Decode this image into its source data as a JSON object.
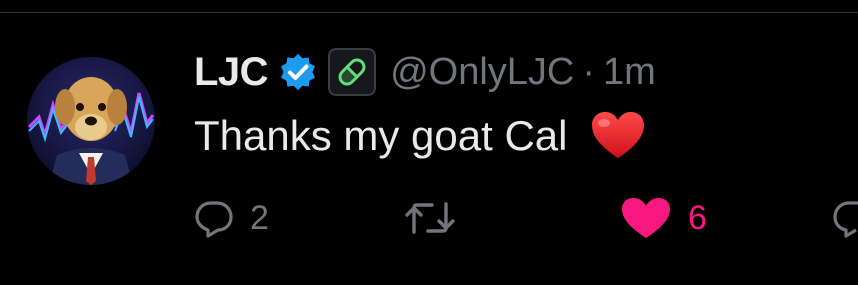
{
  "tweet": {
    "author": {
      "display_name": "LJC",
      "handle": "@OnlyLJC",
      "verified": true,
      "verified_color": "#1d9bf0",
      "badge": "green-pill"
    },
    "separator": "·",
    "time": "1m",
    "text": "Thanks my goat Cal",
    "emoji": "red-heart"
  },
  "actions": {
    "reply": {
      "icon": "reply-icon",
      "count": "2"
    },
    "retweet": {
      "icon": "retweet-icon",
      "count": ""
    },
    "like": {
      "icon": "heart-icon",
      "count": "6",
      "active": true,
      "color": "#f91880"
    },
    "share": {
      "icon": "share-icon"
    }
  }
}
